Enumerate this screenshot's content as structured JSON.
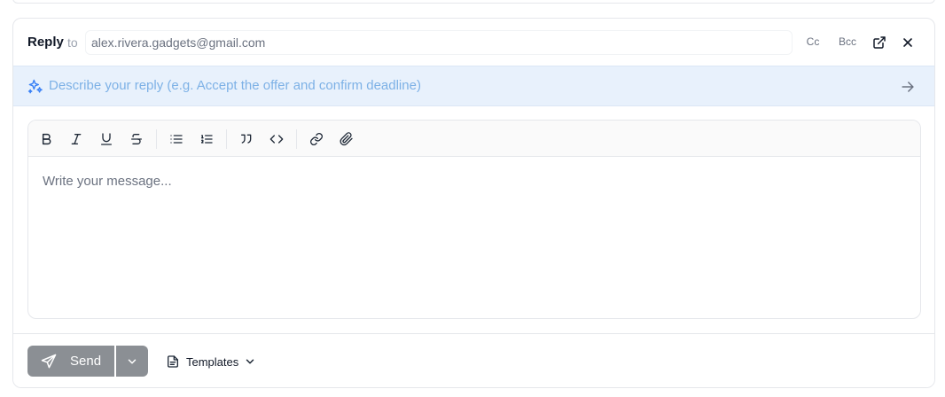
{
  "header": {
    "reply_label": "Reply",
    "to_label": "to",
    "to_value": "alex.rivera.gadgets@gmail.com",
    "cc_label": "Cc",
    "bcc_label": "Bcc",
    "popout_icon": "external-link-icon",
    "close_icon": "close-icon"
  },
  "ai": {
    "icon": "sparkles-icon",
    "placeholder": "Describe your reply (e.g. Accept the offer and confirm deadline)",
    "submit_icon": "arrow-right-icon",
    "accent_color": "#7db1e6"
  },
  "editor": {
    "toolbar": [
      {
        "name": "bold-icon",
        "label": "Bold"
      },
      {
        "name": "italic-icon",
        "label": "Italic"
      },
      {
        "name": "underline-icon",
        "label": "Underline"
      },
      {
        "name": "strikethrough-icon",
        "label": "Strikethrough"
      },
      {
        "name": "bullet-list-icon",
        "label": "Bullet list"
      },
      {
        "name": "numbered-list-icon",
        "label": "Numbered list"
      },
      {
        "name": "quote-icon",
        "label": "Quote"
      },
      {
        "name": "code-icon",
        "label": "Code"
      },
      {
        "name": "link-icon",
        "label": "Link"
      },
      {
        "name": "attachment-icon",
        "label": "Attachment"
      }
    ],
    "placeholder": "Write your message..."
  },
  "footer": {
    "send_label": "Send",
    "send_icon": "send-icon",
    "send_more_icon": "chevron-down-icon",
    "templates_label": "Templates",
    "templates_icon": "document-icon",
    "send_color": "#8b8f94"
  }
}
